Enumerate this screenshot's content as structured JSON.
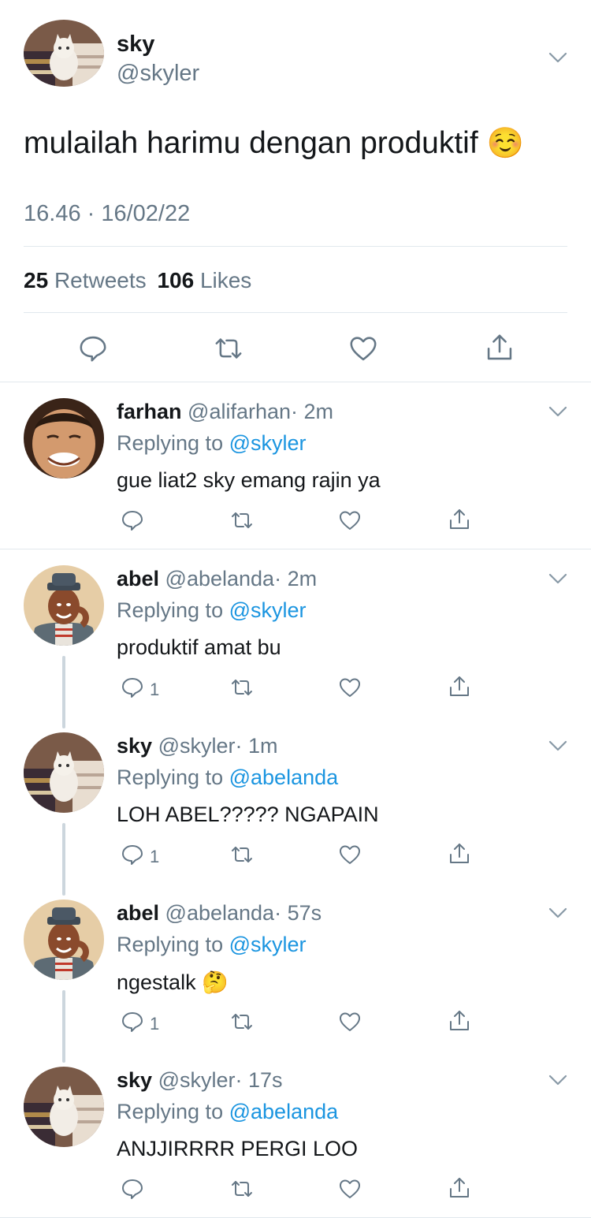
{
  "main_tweet": {
    "name": "sky",
    "handle": "@skyler",
    "text": "mulailah harimu dengan produktif",
    "emoji": "☺️",
    "timestamp": "16.46 · 16/02/22",
    "retweets_count": "25",
    "retweets_label": "Retweets",
    "likes_count": "106",
    "likes_label": "Likes"
  },
  "replying_to_label": "Replying to",
  "replies": [
    {
      "name": "farhan",
      "handle": "@alifarhan",
      "time": "· 2m",
      "reply_to": "@skyler",
      "text": "gue liat2 sky emang rajin ya",
      "reply_count": "",
      "avatar": "child"
    },
    {
      "name": "abel",
      "handle": "@abelanda",
      "time": "· 2m",
      "reply_to": "@skyler",
      "text": "produktif amat bu",
      "reply_count": "1",
      "avatar": "man-hat"
    },
    {
      "name": "sky",
      "handle": "@skyler",
      "time": "· 1m",
      "reply_to": "@abelanda",
      "text": "LOH ABEL????? NGAPAIN",
      "reply_count": "1",
      "avatar": "cat"
    },
    {
      "name": "abel",
      "handle": "@abelanda",
      "time": "· 57s",
      "reply_to": "@skyler",
      "text": "ngestalk",
      "emoji": "🤔",
      "reply_count": "1",
      "avatar": "man-hat"
    },
    {
      "name": "sky",
      "handle": "@skyler",
      "time": "· 17s",
      "reply_to": "@abelanda",
      "text": "ANJJIRRRR PERGI LOO",
      "reply_count": "",
      "avatar": "cat"
    }
  ],
  "icons": [
    "reply-icon",
    "retweet-icon",
    "like-icon",
    "share-icon",
    "chevron-down-icon"
  ],
  "colors": {
    "text": "#14171a",
    "secondary": "#657786",
    "link": "#1b95e0",
    "divider": "#e1e8ed"
  }
}
